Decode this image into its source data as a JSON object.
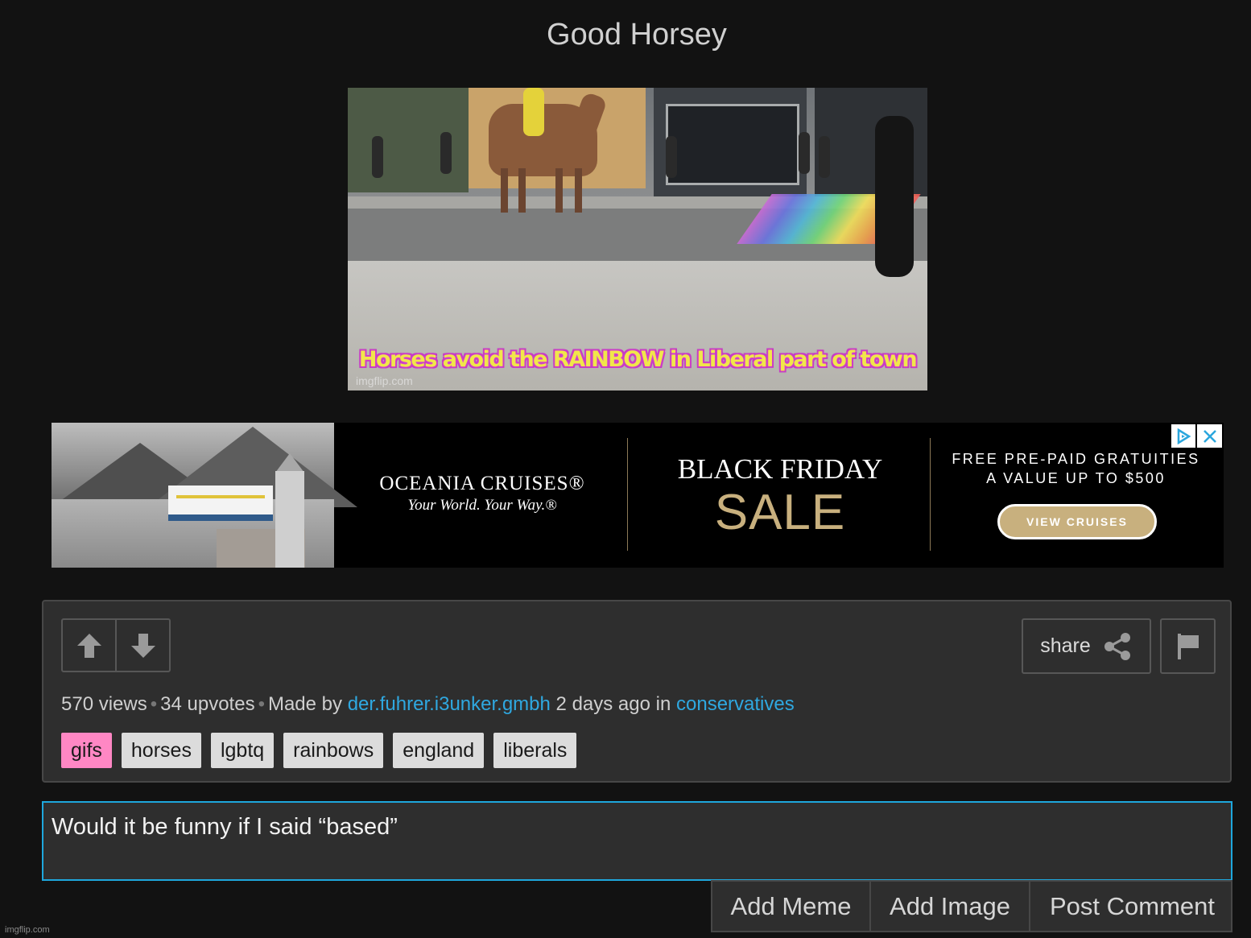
{
  "page": {
    "title": "Good Horsey"
  },
  "meme": {
    "caption": "Horses avoid the RAINBOW in Liberal part of town",
    "watermark": "imgflip.com"
  },
  "ad": {
    "brand": "OCEANIA CRUISES®",
    "tagline": "Your World. Your Way.®",
    "headline": "BLACK FRIDAY",
    "sale": "SALE",
    "offer_line1": "FREE PRE-PAID GRATUITIES",
    "offer_line2": "A VALUE UP TO $500",
    "cta": "VIEW CRUISES",
    "accent_color": "#c8b07e",
    "adchoices_icon": "adchoices-icon",
    "close_icon": "close-icon"
  },
  "post": {
    "views": "570 views",
    "upvotes": "34 upvotes",
    "made_by_label": "Made by",
    "author": "der.fuhrer.i3unker.gmbh",
    "time": "2 days ago in",
    "stream": "conservatives",
    "share_label": "share",
    "tags": [
      "gifs",
      "horses",
      "lgbtq",
      "rainbows",
      "england",
      "liberals"
    ],
    "link_color": "#2fa8e0",
    "highlight_tag_color": "#ff87c4"
  },
  "comment": {
    "value": "Would it be funny if I said “based”",
    "border_color": "#1ea7dd"
  },
  "actions": {
    "add_meme": "Add Meme",
    "add_image": "Add Image",
    "post_comment": "Post Comment"
  },
  "footer": {
    "watermark": "imgflip.com"
  }
}
